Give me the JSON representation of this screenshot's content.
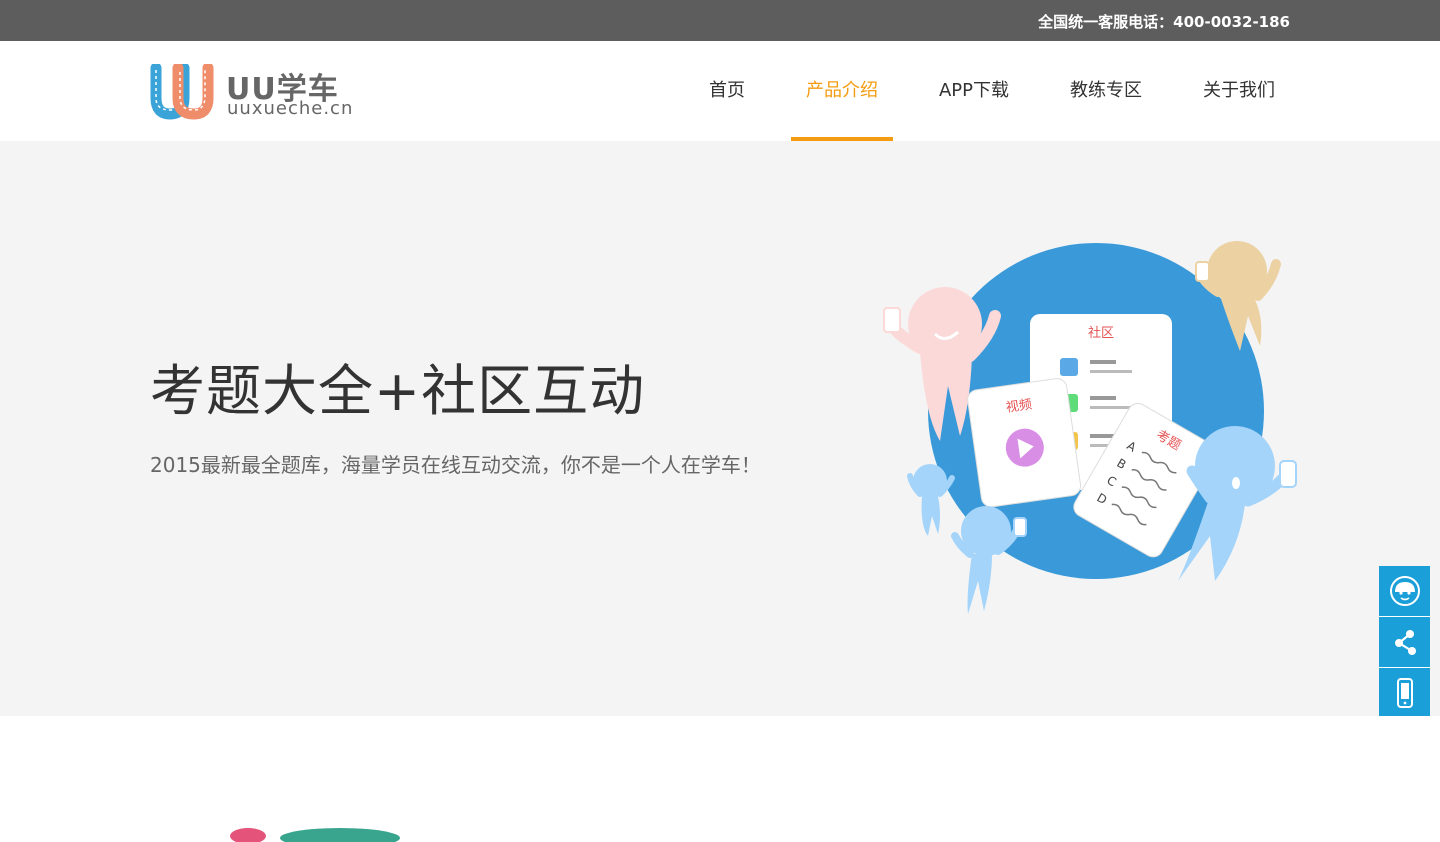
{
  "topbar": {
    "hotline": "全国统一客服电话：400-0032-186"
  },
  "header": {
    "logo": {
      "brand": "UU学车",
      "domain": "uuxueche.cn"
    },
    "nav": [
      {
        "label": "首页",
        "active": false
      },
      {
        "label": "产品介绍",
        "active": true
      },
      {
        "label": "APP下载",
        "active": false
      },
      {
        "label": "教练专区",
        "active": false
      },
      {
        "label": "关于我们",
        "active": false
      }
    ]
  },
  "hero": {
    "title": "考题大全+社区互动",
    "subtitle": "2015最新最全题库，海量学员在线互动交流，你不是一个人在学车！",
    "illustration": {
      "card_community": "社区",
      "card_video": "视频",
      "card_exam": "考题",
      "options": [
        "A",
        "B",
        "C",
        "D"
      ]
    }
  },
  "sidetools": [
    {
      "icon": "customer-service-icon"
    },
    {
      "icon": "share-icon"
    },
    {
      "icon": "mobile-icon"
    }
  ],
  "colors": {
    "accent": "#f39c12",
    "topbar": "#5d5d5d",
    "tool": "#1a9fd9",
    "circle": "#3a9ad9"
  }
}
